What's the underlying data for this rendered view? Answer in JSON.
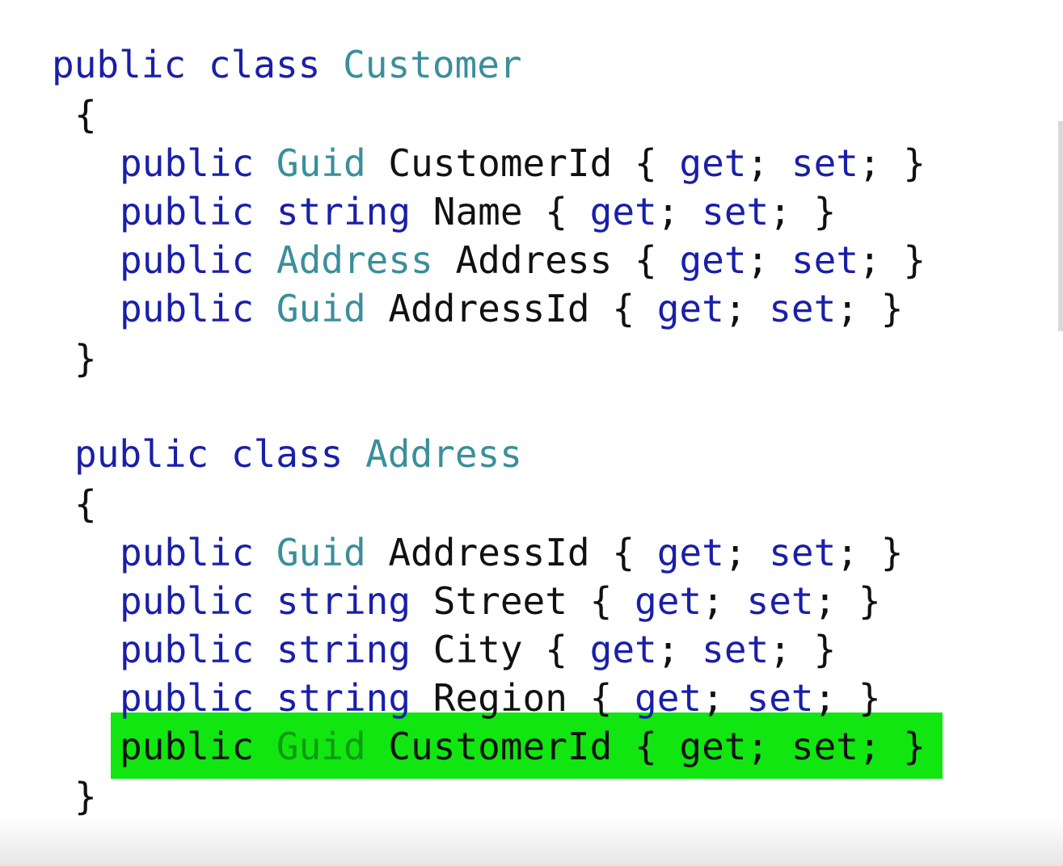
{
  "editor": {
    "lines": [
      {
        "kw1": "public",
        "kw2": "class",
        "type": "Customer"
      },
      {
        "text": "{"
      },
      {
        "kw": "public",
        "type": "Guid",
        "ident": "CustomerId",
        "open": "{",
        "get": "get",
        "semi1": ";",
        "set": "set",
        "semi2": ";",
        "close": "}"
      },
      {
        "kw": "public",
        "type": "string",
        "ident": "Name",
        "open": "{",
        "get": "get",
        "semi1": ";",
        "set": "set",
        "semi2": ";",
        "close": "}"
      },
      {
        "kw": "public",
        "type": "Address",
        "ident": "Address",
        "open": "{",
        "get": "get",
        "semi1": ";",
        "set": "set",
        "semi2": ";",
        "close": "}"
      },
      {
        "kw": "public",
        "type": "Guid",
        "ident": "AddressId",
        "open": "{",
        "get": "get",
        "semi1": ";",
        "set": "set",
        "semi2": ";",
        "close": "}"
      },
      {
        "text": "}"
      },
      {
        "kw1": "public",
        "kw2": "class",
        "type": "Address"
      },
      {
        "text": "{"
      },
      {
        "kw": "public",
        "type": "Guid",
        "ident": "AddressId",
        "open": "{",
        "get": "get",
        "semi1": ";",
        "set": "set",
        "semi2": ";",
        "close": "}"
      },
      {
        "kw": "public",
        "type": "string",
        "ident": "Street",
        "open": "{",
        "get": "get",
        "semi1": ";",
        "set": "set",
        "semi2": ";",
        "close": "}"
      },
      {
        "kw": "public",
        "type": "string",
        "ident": "City",
        "open": "{",
        "get": "get",
        "semi1": ";",
        "set": "set",
        "semi2": ";",
        "close": "}"
      },
      {
        "kw": "public",
        "type": "string",
        "ident": "Region",
        "open": "{",
        "get": "get",
        "semi1": ";",
        "set": "set",
        "semi2": ";",
        "close": "}"
      },
      {
        "kw": "public",
        "type": "Guid",
        "ident": "CustomerId",
        "open": "{",
        "get": "get",
        "semi1": ";",
        "set": "set",
        "semi2": ";",
        "close": "}"
      },
      {
        "text": "}"
      }
    ]
  },
  "colors": {
    "keyword": "#1a1fa8",
    "type": "#3a8f9a",
    "identifier": "#111111",
    "highlight": "#11e611"
  }
}
